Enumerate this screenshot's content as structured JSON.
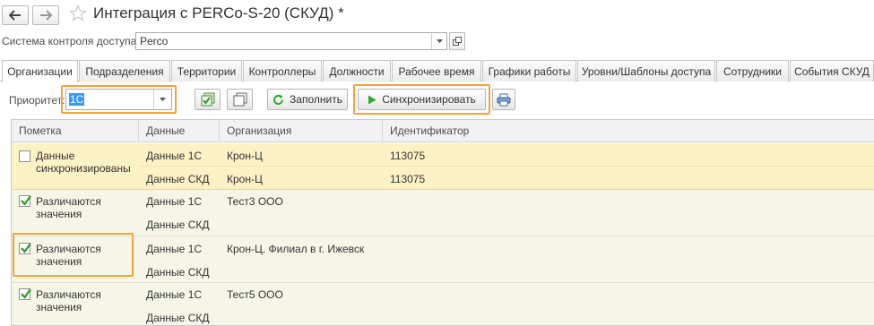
{
  "window": {
    "title": "Интеграция с PERCo-S-20 (СКУД) *"
  },
  "access_system": {
    "label": "Система контроля доступа:",
    "value": "Perco"
  },
  "tabs": [
    {
      "label": "Организации",
      "active": true
    },
    {
      "label": "Подразделения"
    },
    {
      "label": "Территории"
    },
    {
      "label": "Контроллеры"
    },
    {
      "label": "Должности"
    },
    {
      "label": "Рабочее время"
    },
    {
      "label": "Графики работы"
    },
    {
      "label": "Уровни/Шаблоны доступа"
    },
    {
      "label": "Сотрудники"
    },
    {
      "label": "События СКУД"
    }
  ],
  "toolbar": {
    "priority_label": "Приоритет:",
    "priority_value": "1С",
    "fill_label": "Заполнить",
    "sync_label": "Синхронизировать"
  },
  "table": {
    "columns": [
      "Пометка",
      "Данные",
      "Организация",
      "Идентификатор"
    ],
    "groups": [
      {
        "checked": false,
        "mark_lines": [
          "Данные",
          "синхронизированы"
        ],
        "highlight": "#fdf2c5",
        "rows": [
          {
            "data": "Данные 1С",
            "org": "Крон-Ц",
            "id": "113075"
          },
          {
            "data": "Данные СКД",
            "org": "Крон-Ц",
            "id": "113075"
          }
        ]
      },
      {
        "checked": true,
        "mark_lines": [
          "Различаются",
          "значения"
        ],
        "highlight": "#f6f6e8",
        "rows": [
          {
            "data": "Данные 1С",
            "org": "Тест3 ООО",
            "id": ""
          },
          {
            "data": "Данные СКД",
            "org": "",
            "id": ""
          }
        ]
      },
      {
        "checked": true,
        "mark_lines": [
          "Различаются",
          "значения"
        ],
        "highlight": "#f6f6e8",
        "rows": [
          {
            "data": "Данные 1С",
            "org": "Крон-Ц. Филиал в г. Ижевск",
            "id": ""
          },
          {
            "data": "Данные СКД",
            "org": "",
            "id": ""
          }
        ]
      },
      {
        "checked": true,
        "mark_lines": [
          "Различаются",
          "значения"
        ],
        "highlight": "#f6f6e8",
        "rows": [
          {
            "data": "Данные 1С",
            "org": "Тест5 ООО",
            "id": ""
          },
          {
            "data": "Данные СКД",
            "org": "",
            "id": ""
          }
        ]
      }
    ]
  },
  "colors": {
    "annotation_highlight": "#f2a43a",
    "selection": "#3399ff",
    "sync_green": "#2eaa2e",
    "check_green": "#2a9a2a"
  }
}
